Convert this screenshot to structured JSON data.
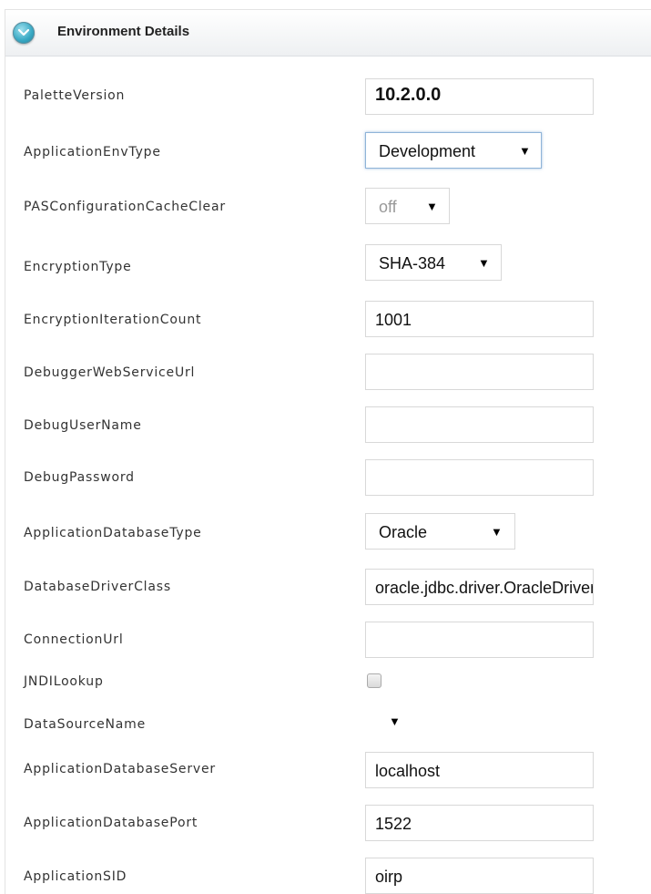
{
  "header": {
    "title": "Environment Details"
  },
  "rows": {
    "palette_version": {
      "label": "PaletteVersion",
      "value": "10.2.0.0"
    },
    "app_env_type": {
      "label": "ApplicationEnvType",
      "value": "Development"
    },
    "pas_cache_clear": {
      "label": "PASConfigurationCacheClear",
      "value": "off"
    },
    "encryption_type": {
      "label": "EncryptionType",
      "value": "SHA-384"
    },
    "encryption_iter": {
      "label": "EncryptionIterationCount",
      "value": "1001"
    },
    "debugger_url": {
      "label": "DebuggerWebServiceUrl",
      "value": ""
    },
    "debug_user": {
      "label": "DebugUserName",
      "value": ""
    },
    "debug_password": {
      "label": "DebugPassword",
      "value": ""
    },
    "app_db_type": {
      "label": "ApplicationDatabaseType",
      "value": "Oracle"
    },
    "db_driver_class": {
      "label": "DatabaseDriverClass",
      "value": "oracle.jdbc.driver.OracleDriver"
    },
    "connection_url": {
      "label": "ConnectionUrl",
      "value": ""
    },
    "jndi_lookup": {
      "label": "JNDILookup",
      "checked": false
    },
    "datasource_name": {
      "label": "DataSourceName",
      "value": ""
    },
    "app_db_server": {
      "label": "ApplicationDatabaseServer",
      "value": "localhost"
    },
    "app_db_port": {
      "label": "ApplicationDatabasePort",
      "value": "1522"
    },
    "app_sid": {
      "label": "ApplicationSID",
      "value": "oirp"
    }
  },
  "icons": {
    "dropdown_arrow": "▼",
    "collapse": "chevron-down-icon"
  },
  "colors": {
    "accent": "#39a9c4",
    "border": "#d8d8d8"
  }
}
